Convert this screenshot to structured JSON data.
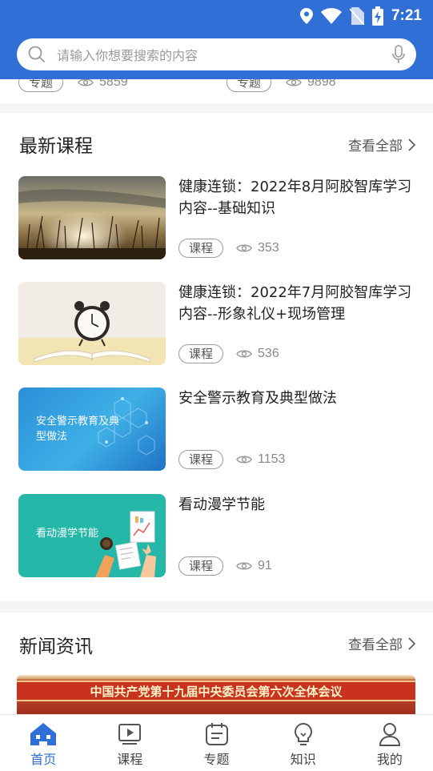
{
  "status": {
    "time": "7:21"
  },
  "search": {
    "placeholder": "请输入你想要搜索的内容"
  },
  "top_items": [
    {
      "tag": "专题",
      "views": "5859"
    },
    {
      "tag": "专题",
      "views": "9898"
    }
  ],
  "courses": {
    "title": "最新课程",
    "more": "查看全部",
    "items": [
      {
        "title": "健康连锁：2022年8月阿胶智库学习内容--基础知识",
        "tag": "课程",
        "views": "353"
      },
      {
        "title": "健康连锁：2022年7月阿胶智库学习内容--形象礼仪+现场管理",
        "tag": "课程",
        "views": "536"
      },
      {
        "title": "安全警示教育及典型做法",
        "tag": "课程",
        "views": "1153",
        "thumb_text": "安全警示教育及典型做法"
      },
      {
        "title": "看动漫学节能",
        "tag": "课程",
        "views": "91",
        "thumb_text": "看动漫学节能"
      }
    ]
  },
  "news": {
    "title": "新闻资讯",
    "more": "查看全部",
    "banner_text": "中国共产党第十九届中央委员会第六次全体会议"
  },
  "tabs": [
    {
      "label": "首页",
      "active": true
    },
    {
      "label": "课程"
    },
    {
      "label": "专题"
    },
    {
      "label": "知识"
    },
    {
      "label": "我的"
    }
  ],
  "colors": {
    "primary": "#2f6fd6"
  }
}
